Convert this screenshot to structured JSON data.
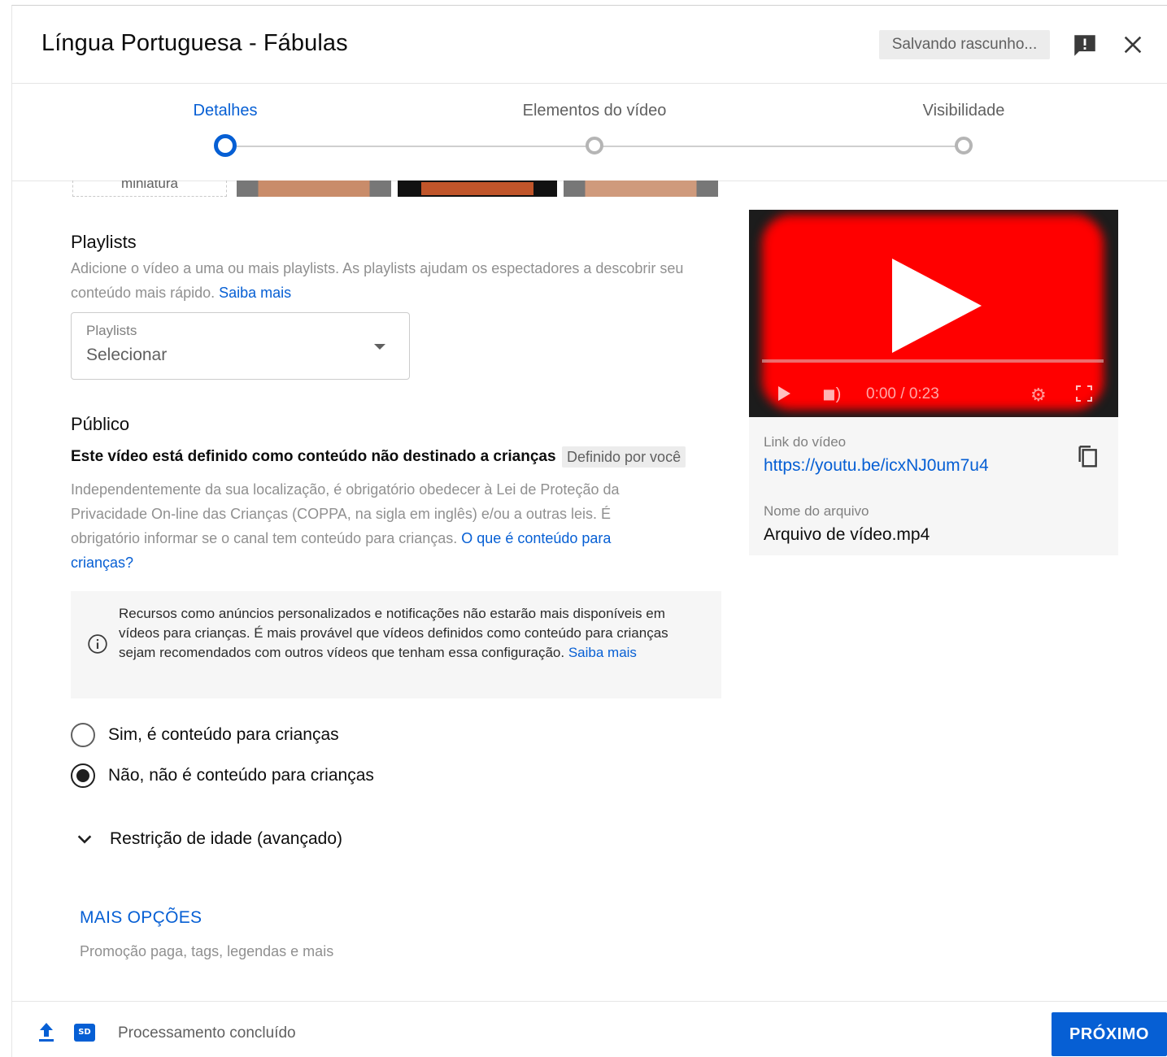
{
  "header": {
    "title": "Língua Portuguesa - Fábulas",
    "draft_status": "Salvando rascunho..."
  },
  "stepper": {
    "steps": [
      {
        "label": "Detalhes",
        "active": true
      },
      {
        "label": "Elementos do vídeo",
        "active": false
      },
      {
        "label": "Visibilidade",
        "active": false
      }
    ]
  },
  "thumbnails": {
    "upload_label": "miniatura"
  },
  "playlists": {
    "title": "Playlists",
    "help": "Adicione o vídeo a uma ou mais playlists. As playlists ajudam os espectadores a descobrir seu conteúdo mais rápido.",
    "help_link": "Saiba mais",
    "select_label": "Playlists",
    "select_value": "Selecionar"
  },
  "audience": {
    "title": "Público",
    "status": "Este vídeo está definido como conteúdo não destinado a crianças",
    "badge": "Definido por você",
    "help": "Independentemente da sua localização, é obrigatório obedecer à Lei de Proteção da Privacidade On-line das Crianças (COPPA, na sigla em inglês) e/ou a outras leis. É obrigatório informar se o canal tem conteúdo para crianças.",
    "help_link": "O que é conteúdo para crianças?",
    "info_text": "Recursos como anúncios personalizados e notificações não estarão mais disponíveis em vídeos para crianças. É mais provável que vídeos definidos como conteúdo para crianças sejam recomendados com outros vídeos que tenham essa configuração.",
    "info_link": "Saiba mais",
    "options": [
      {
        "label": "Sim, é conteúdo para crianças",
        "checked": false
      },
      {
        "label": "Não, não é conteúdo para crianças",
        "checked": true
      }
    ]
  },
  "age_restriction": {
    "label": "Restrição de idade (avançado)"
  },
  "more_options": {
    "label": "MAIS OPÇÕES",
    "sub": "Promoção paga, tags, legendas e mais"
  },
  "preview": {
    "time": "0:00 / 0:23",
    "link_label": "Link do vídeo",
    "link": "https://youtu.be/icxNJ0um7u4",
    "file_label": "Nome do arquivo",
    "file_name": "Arquivo de vídeo.mp4"
  },
  "footer": {
    "sd_badge": "SD",
    "status": "Processamento concluído",
    "next_label": "PRÓXIMO"
  },
  "colors": {
    "accent": "#065fd4",
    "video_red": "#ff0000"
  }
}
